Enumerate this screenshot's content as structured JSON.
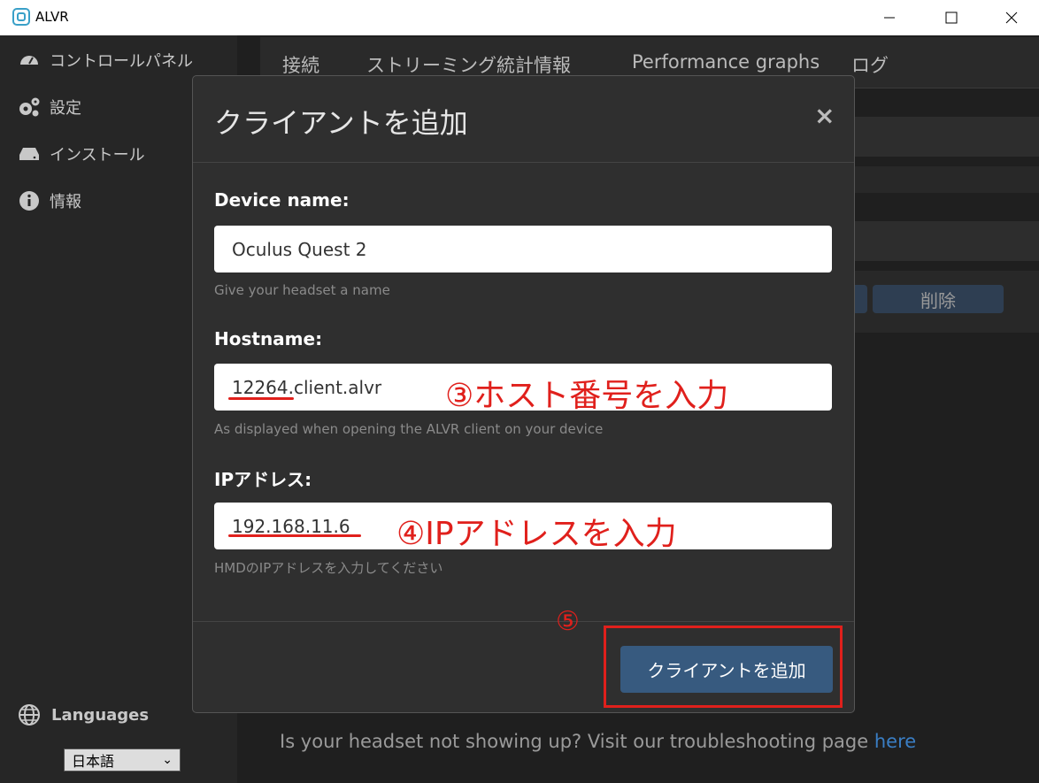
{
  "window": {
    "title": "ALVR"
  },
  "sidebar": {
    "items": [
      {
        "label": "コントロールパネル",
        "icon": "gauge-icon"
      },
      {
        "label": "設定",
        "icon": "gears-icon"
      },
      {
        "label": "インストール",
        "icon": "hdd-icon"
      },
      {
        "label": "情報",
        "icon": "info-icon"
      }
    ],
    "languages_label": "Languages",
    "language_selected": "日本語"
  },
  "tabs": [
    {
      "label": "接続"
    },
    {
      "label": "ストリーミング統計情報"
    },
    {
      "label": "Performance graphs"
    },
    {
      "label": "ログ"
    }
  ],
  "background": {
    "delete_label": "削除",
    "trouble_text": "Is your headset not showing up? Visit our troubleshooting page ",
    "trouble_link": "here"
  },
  "modal": {
    "title": "クライアントを追加",
    "close_label": "×",
    "device_name": {
      "label": "Device name:",
      "value": "Oculus Quest 2",
      "help": "Give your headset a name"
    },
    "hostname": {
      "label": "Hostname:",
      "value": "12264.client.alvr",
      "help": "As displayed when opening the ALVR client on your device"
    },
    "ip": {
      "label": "IPアドレス:",
      "value": "192.168.11.6",
      "help": "HMDのIPアドレスを入力してください"
    },
    "submit_label": "クライアントを追加"
  },
  "annotations": {
    "step3": "③ホスト番号を入力",
    "step4": "④IPアドレスを入力",
    "step5": "⑤"
  },
  "colors": {
    "annotation": "#e0201c",
    "primary_button": "#375a7f",
    "link": "#3a7ec4"
  }
}
